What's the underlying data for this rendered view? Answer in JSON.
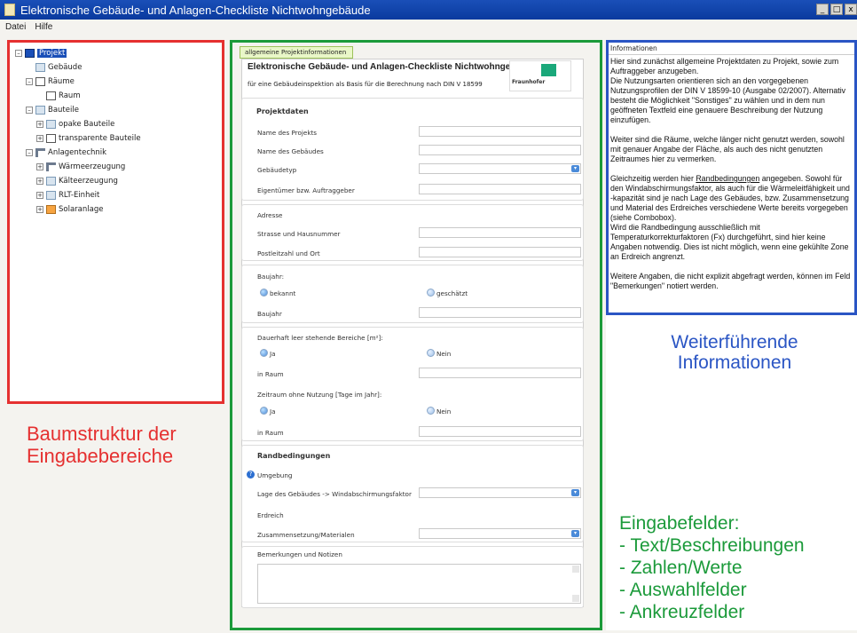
{
  "window": {
    "title": "Elektronische Gebäude- und Anlagen-Checkliste Nichtwohngebäude",
    "buttons": [
      "_",
      "□",
      "x"
    ]
  },
  "menu": [
    "Datei",
    "Hilfe"
  ],
  "tree": {
    "items": [
      {
        "label": "Projekt",
        "depth": 0,
        "exp": "–",
        "icon": "i-save",
        "name": "save-icon"
      },
      {
        "label": "Gebäude",
        "depth": 1,
        "exp": "",
        "icon": "i-doc",
        "name": "building-icon"
      },
      {
        "label": "Räume",
        "depth": 1,
        "exp": "–",
        "icon": "i-room",
        "name": "room-icon"
      },
      {
        "label": "Raum",
        "depth": 2,
        "exp": "",
        "icon": "i-room",
        "name": "room-icon"
      },
      {
        "label": "Bauteile",
        "depth": 1,
        "exp": "–",
        "icon": "i-doc",
        "name": "component-icon"
      },
      {
        "label": "opake Bauteile",
        "depth": 2,
        "exp": "+",
        "icon": "i-doc",
        "name": "component-icon"
      },
      {
        "label": "transparente Bauteile",
        "depth": 2,
        "exp": "+",
        "icon": "i-room",
        "name": "window-icon"
      },
      {
        "label": "Anlagentechnik",
        "depth": 1,
        "exp": "–",
        "icon": "i-pipe",
        "name": "pipe-icon"
      },
      {
        "label": "Wärmeerzeugung",
        "depth": 2,
        "exp": "+",
        "icon": "i-pipe",
        "name": "pipe-icon"
      },
      {
        "label": "Kälteerzeugung",
        "depth": 2,
        "exp": "+",
        "icon": "i-doc",
        "name": "cooling-icon"
      },
      {
        "label": "RLT-Einheit",
        "depth": 2,
        "exp": "+",
        "icon": "i-doc",
        "name": "ventilation-icon"
      },
      {
        "label": "Solaranlage",
        "depth": 2,
        "exp": "+",
        "icon": "i-orange",
        "name": "solar-icon"
      }
    ]
  },
  "form": {
    "tab": "allgemeine Projektinformationen",
    "title": "Elektronische Gebäude- und Anlagen-Checkliste Nichtwohngebäude",
    "subtitle": "für eine Gebäudeinspektion als Basis für die Berechnung nach DIN V 18599",
    "logo": {
      "brand": "Fraunhofer",
      "institute": "Institut Bauphysik",
      "badge": "IBP"
    },
    "projektdaten": "Projektdaten",
    "name_projekt": "Name des Projekts",
    "name_gebaeude": "Name des Gebäudes",
    "gebaeudetyp": "Gebäudetyp",
    "eigentuemer": "Eigentümer bzw. Auftraggeber",
    "adresse": "Adresse",
    "strasse": "Strasse und Hausnummer",
    "plz": "Postleitzahl und Ort",
    "baujahr_title": "Baujahr:",
    "bekannt": "bekannt",
    "geschaetzt": "geschätzt",
    "baujahr": "Baujahr",
    "leer_title": "Dauerhaft leer stehende Bereiche [m²]:",
    "ja": "Ja",
    "nein": "Nein",
    "in_raum": "in Raum",
    "zeitraum_title": "Zeitraum ohne Nutzung [Tage im Jahr]:",
    "randbedingungen": "Randbedingungen",
    "umgebung": "Umgebung",
    "lage": "Lage des Gebäudes -> Windabschirmungsfaktor",
    "erdreich": "Erdreich",
    "zusammensetzung": "Zusammensetzung/Materialen",
    "bemerkungen": "Bemerkungen und Notizen"
  },
  "info": {
    "header": "Informationen",
    "p1": "Hier sind zunächst allgemeine Projektdaten zu Projekt, sowie zum Auftraggeber anzugeben.",
    "p2": "Die Nutzungsarten orientieren sich an den vorgegebenen Nutzungsprofilen der DIN V 18599-10 (Ausgabe 02/2007). Alternativ besteht die Möglichkeit \"Sonstiges\" zu wählen und in dem nun geöffneten Textfeld eine genauere Beschreibung der Nutzung einzufügen.",
    "p3": "Weiter sind die Räume, welche länger nicht genutzt werden, sowohl mit genauer Angabe der Fläche, als auch des nicht genutzten Zeitraumes hier zu vermerken.",
    "p4a": "Gleichzeitig werden hier ",
    "p4u": "Randbedingungen",
    "p4b": " angegeben. Sowohl für den Windabschirmungsfaktor, als auch für die Wärmeleitfähigkeit und -kapazität sind je nach Lage des Gebäudes, bzw. Zusammensetzung und Material des Erdreiches verschiedene Werte bereits vorgegeben (siehe Combobox).",
    "p5": "Wird die Randbedingung ausschließlich mit Temperaturkorrekturfaktoren (Fx) durchgeführt, sind hier keine Angaben notwendig. Dies ist nicht möglich, wenn eine gekühlte Zone an Erdreich angrenzt.",
    "p6": "Weitere Angaben, die nicht explizit abgefragt werden, können im Feld \"Bemerkungen\" notiert werden."
  },
  "annotations": {
    "red": [
      "Baumstruktur der",
      "Eingabebereiche"
    ],
    "blue": [
      "Weiterführende",
      "Informationen"
    ],
    "green": [
      "Eingabefelder:",
      "- Text/Beschreibungen",
      "- Zahlen/Werte",
      "- Auswahlfelder",
      "- Ankreuzfelder"
    ]
  },
  "colors": {
    "red": "#e53030",
    "green": "#1b9a3a",
    "blue": "#2a55c4",
    "titlebar": "#1a4fb8"
  }
}
